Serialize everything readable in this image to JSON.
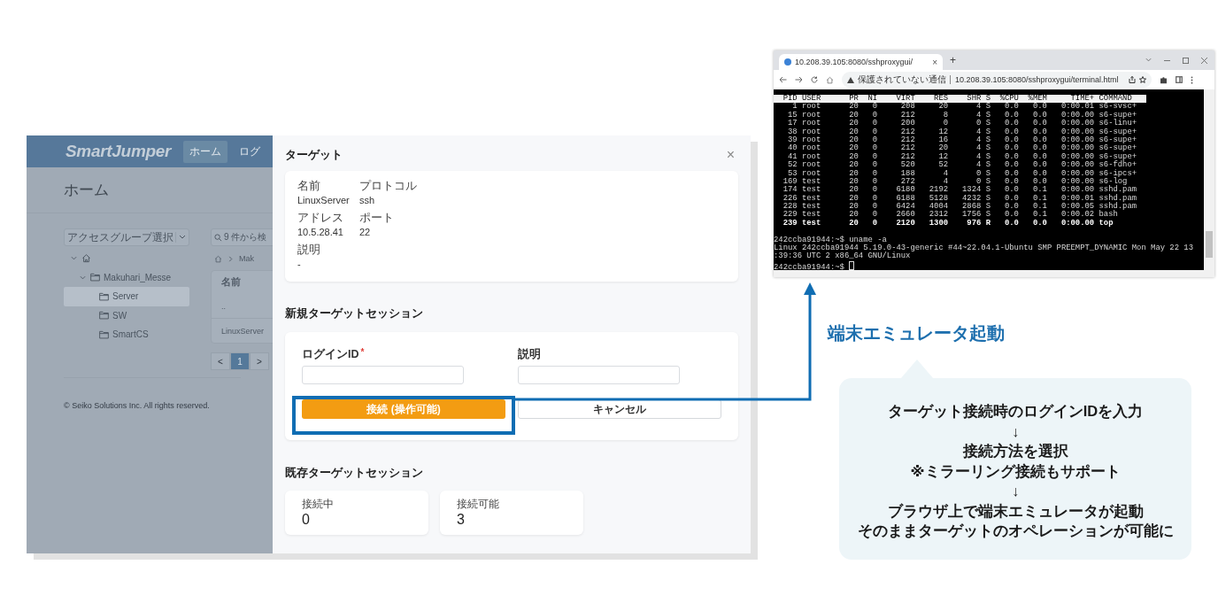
{
  "app": {
    "logo": "SmartJumper",
    "nav": [
      {
        "label": "ホーム",
        "selected": true
      },
      {
        "label": "ログ",
        "selected": false
      }
    ],
    "page_title": "ホーム",
    "group_select": {
      "placeholder": "アクセスグループ選択"
    },
    "tree": [
      {
        "kind": "home",
        "expanded": true,
        "selected": false,
        "children": [
          {
            "kind": "folder",
            "label": "Makuhari_Messe",
            "expanded": true,
            "selected": false,
            "children": [
              {
                "kind": "folder",
                "label": "Server",
                "selected": true
              },
              {
                "kind": "folder",
                "label": "SW",
                "selected": false
              },
              {
                "kind": "folder",
                "label": "SmartCS",
                "selected": false
              }
            ]
          }
        ]
      }
    ],
    "search": {
      "placeholder": "9 件から検"
    },
    "breadcrumb": [
      "Mak"
    ],
    "table": {
      "columns": [
        "名前"
      ],
      "rows": [
        [
          ".."
        ],
        [
          "LinuxServer"
        ]
      ]
    },
    "pagination": {
      "prev": "<",
      "pages": [
        {
          "label": "1",
          "selected": true
        }
      ],
      "next": ">"
    },
    "footer": "© Seiko Solutions Inc. All rights reserved."
  },
  "dialog": {
    "title": "ターゲット",
    "close": "×",
    "target_fields": [
      {
        "label": "名前",
        "value": "LinuxServer"
      },
      {
        "label": "プロトコル",
        "value": "ssh"
      },
      {
        "label": "アドレス",
        "value": "10.5.28.41"
      },
      {
        "label": "ポート",
        "value": "22"
      },
      {
        "label": "説明",
        "value": "-"
      }
    ],
    "new_session": {
      "title": "新規ターゲットセッション",
      "required_mark": "*",
      "fields": [
        {
          "label": "ログインID",
          "required": true
        },
        {
          "label": "説明",
          "required": false
        }
      ],
      "buttons": [
        {
          "label": "接続 (操作可能)",
          "kind": "primary",
          "highlighted": true
        },
        {
          "label": "キャンセル",
          "kind": "default",
          "highlighted": false
        }
      ]
    },
    "existing_sessions": {
      "title": "既存ターゲットセッション",
      "stats": [
        {
          "label": "接続中",
          "value": "0"
        },
        {
          "label": "接続可能",
          "value": "3"
        }
      ]
    }
  },
  "browser": {
    "tab_title": "10.208.39.105:8080/sshproxygui/",
    "tab_close": "×",
    "new_tab": "+",
    "security": "保護されていない通信",
    "url": "10.208.39.105:8080/sshproxygui/terminal.html",
    "terminal": {
      "header": "  PID USER      PR  NI    VIRT    RES    SHR S  %CPU  %MEM     TIME+ COMMAND",
      "rows": [
        {
          "text": "    1 root      20   0     208     20      4 S   0.0   0.0   0:00.01 s6-svsc+",
          "bold": false
        },
        {
          "text": "   15 root      20   0     212      8      4 S   0.0   0.0   0:00.00 s6-supe+",
          "bold": false
        },
        {
          "text": "   17 root      20   0     200      0      0 S   0.0   0.0   0:00.00 s6-linu+",
          "bold": false
        },
        {
          "text": "   38 root      20   0     212     12      4 S   0.0   0.0   0:00.00 s6-supe+",
          "bold": false
        },
        {
          "text": "   39 root      20   0     212     16      4 S   0.0   0.0   0:00.00 s6-supe+",
          "bold": false
        },
        {
          "text": "   40 root      20   0     212     20      4 S   0.0   0.0   0:00.00 s6-supe+",
          "bold": false
        },
        {
          "text": "   41 root      20   0     212     12      4 S   0.0   0.0   0:00.00 s6-supe+",
          "bold": false
        },
        {
          "text": "   52 root      20   0     520     52      4 S   0.0   0.0   0:00.00 s6-fdho+",
          "bold": false
        },
        {
          "text": "   53 root      20   0     188      4      0 S   0.0   0.0   0:00.00 s6-ipcs+",
          "bold": false
        },
        {
          "text": "  169 test      20   0     272      4      0 S   0.0   0.0   0:00.00 s6-log",
          "bold": false
        },
        {
          "text": "  174 test      20   0    6180   2192   1324 S   0.0   0.1   0:00.00 sshd.pam",
          "bold": false
        },
        {
          "text": "  226 test      20   0    6188   5128   4232 S   0.0   0.1   0:00.01 sshd.pam",
          "bold": false
        },
        {
          "text": "  228 test      20   0    6424   4004   2868 S   0.0   0.1   0:00.05 sshd.pam",
          "bold": false
        },
        {
          "text": "  229 test      20   0    2660   2312   1756 S   0.0   0.1   0:00.02 bash",
          "bold": false
        },
        {
          "text": "  239 test      20   0    2120   1300    976 R   0.0   0.0   0:00.00 top",
          "bold": true
        }
      ],
      "lines": [
        "242ccba91944:~$ uname -a",
        "Linux 242ccba91944 5.19.0-43-generic #44~22.04.1-Ubuntu SMP PREEMPT_DYNAMIC Mon May 22 13",
        ":39:36 UTC 2 x86_64 GNU/Linux"
      ],
      "prompt": "242ccba91944:~$"
    }
  },
  "annotation": {
    "title": "端末エミュレータ起動",
    "bubble_lines": [
      "ターゲット接続時のログインIDを入力",
      "↓",
      "接続方法を選択",
      "※ミラーリング接続もサポート",
      "↓",
      "ブラウザ上で端末エミュレータが起動",
      "そのままターゲットのオペレーションが可能に"
    ]
  }
}
